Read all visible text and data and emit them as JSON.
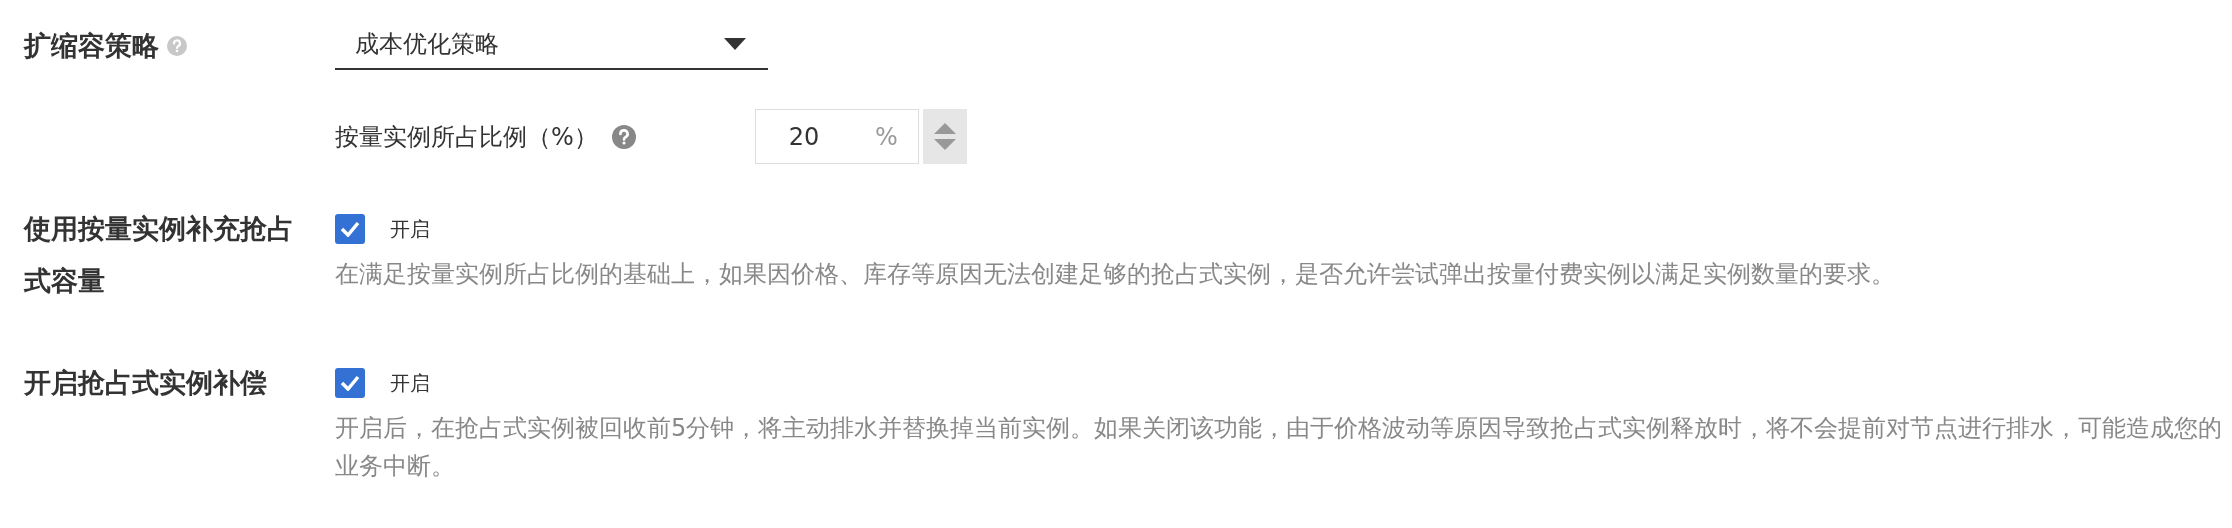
{
  "fields": [
    {
      "kind": "select",
      "label": "扩缩容策略",
      "help": true,
      "value": "成本优化策略",
      "sub_field": {
        "label": "按量实例所占比例（%）",
        "help": true,
        "value": "20",
        "unit": "%"
      }
    },
    {
      "kind": "checkbox",
      "label": "使用按量实例补充抢占式容量",
      "checked": true,
      "option": "开启",
      "description": "在满足按量实例所占比例的基础上，如果因价格、库存等原因无法创建足够的抢占式实例，是否允许尝试弹出按量付费实例以满足实例数量的要求。"
    },
    {
      "kind": "checkbox",
      "label": "开启抢占式实例补偿",
      "checked": true,
      "option": "开启",
      "description": "开启后，在抢占式实例被回收前5分钟，将主动排水并替换掉当前实例。如果关闭该功能，由于价格波动等原因导致抢占式实例释放时，将不会提前对节点进行排水，可能造成您的业务中断。"
    }
  ]
}
